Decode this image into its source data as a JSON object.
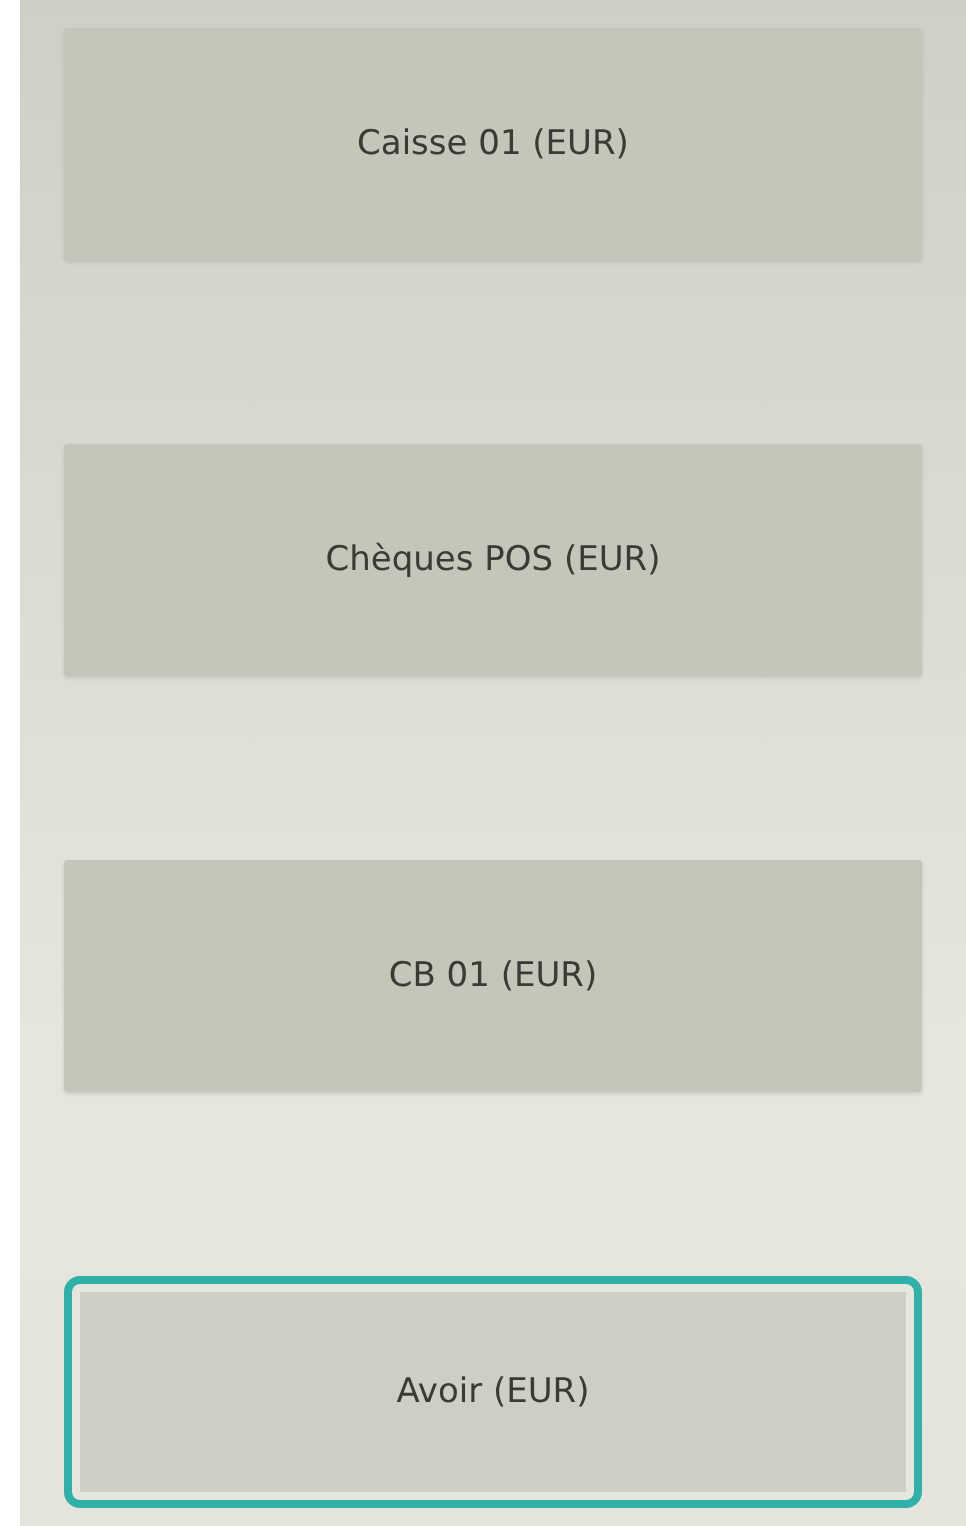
{
  "payment_methods": [
    {
      "label": "Caisse 01 (EUR)",
      "selected": false
    },
    {
      "label": "Chèques POS (EUR)",
      "selected": false
    },
    {
      "label": "CB 01 (EUR)",
      "selected": false
    },
    {
      "label": "Avoir (EUR)",
      "selected": true
    }
  ]
}
